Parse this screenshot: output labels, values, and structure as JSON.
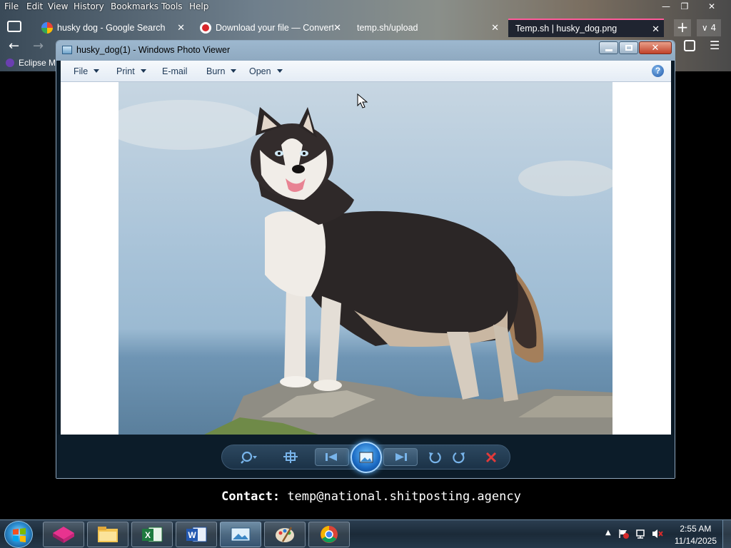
{
  "firefox": {
    "menu": [
      "File",
      "Edit",
      "View",
      "History",
      "Bookmarks",
      "Tools",
      "Help"
    ],
    "tabs": [
      {
        "title": "husky dog - Google Search",
        "icon": "google-icon"
      },
      {
        "title": "Download your file — Converti",
        "icon": "converter-icon"
      },
      {
        "title": "temp.sh/upload",
        "icon": ""
      },
      {
        "title": "Temp.sh | husky_dog.png",
        "icon": "",
        "active": true
      }
    ],
    "tab_count_badge": "4",
    "bookmark": "Eclipse M"
  },
  "photo_viewer": {
    "title": "husky_dog(1) - Windows Photo Viewer",
    "menu": [
      "File",
      "Print",
      "E-mail",
      "Burn",
      "Open"
    ],
    "help": "?"
  },
  "page_text": {
    "contact_label": "Contact:",
    "contact_email": "temp@national.shitposting.agency"
  },
  "taskbar": {
    "apps": [
      "paint-3d-icon",
      "file-explorer-icon",
      "excel-icon",
      "word-icon",
      "photo-viewer-icon",
      "paint-icon",
      "chrome-icon"
    ],
    "time": "2:55 AM",
    "date": "11/14/2025"
  },
  "colors": {
    "active_tab_accent": "#ff5b9a",
    "viewer_frame": "#8fa7bd",
    "taskbar": "#1b2a38"
  }
}
